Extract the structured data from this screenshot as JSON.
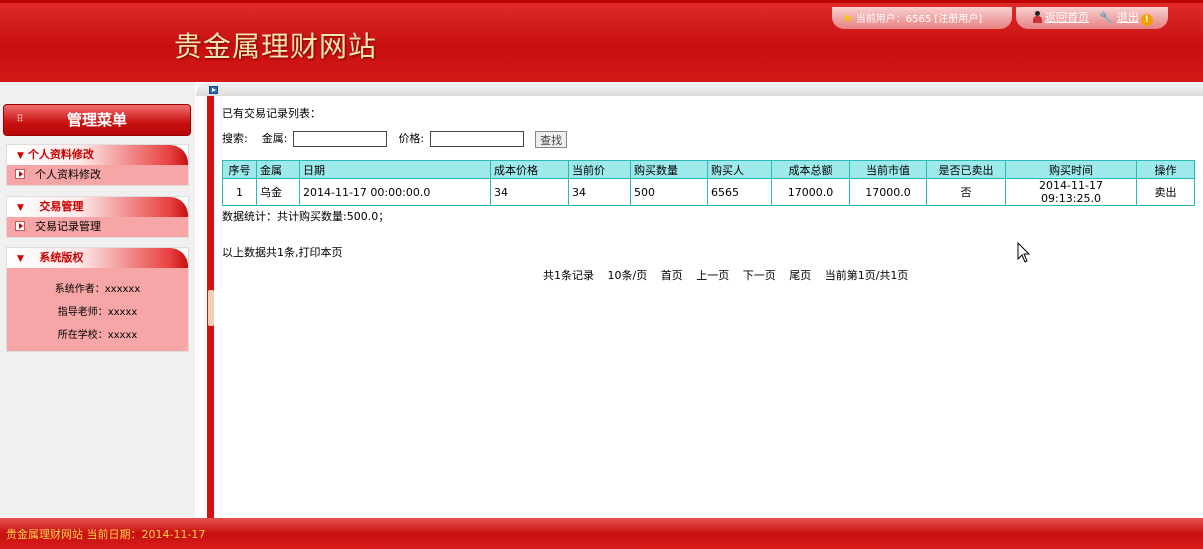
{
  "header": {
    "site_title": "贵金属理财网站",
    "current_user": "当前用户：6565 [注册用户]",
    "home_link": "返回首页",
    "logout_link": "退出"
  },
  "sidebar": {
    "menu_title": "管理菜单",
    "sections": [
      {
        "head": "个人资料修改",
        "items": [
          "个人资料修改"
        ]
      },
      {
        "head": "交易管理",
        "items": [
          "交易记录管理"
        ]
      },
      {
        "head": "系统版权",
        "lines": [
          "系统作者：xxxxxx",
          "指导老师：xxxxx",
          "所在学校：xxxxx"
        ]
      }
    ]
  },
  "content": {
    "list_caption": "已有交易记录列表：",
    "search": {
      "label": "搜索:",
      "metal_label": "金属:",
      "metal_value": "",
      "price_label": "价格:",
      "price_value": "",
      "button": "查找"
    },
    "table": {
      "columns": [
        "序号",
        "金属",
        "日期",
        "成本价格",
        "当前价",
        "购买数量",
        "购买人",
        "成本总额",
        "当前市值",
        "是否已卖出",
        "购买时间",
        "操作"
      ],
      "rows": [
        [
          "1",
          "乌金",
          "2014-11-17 00:00:00.0",
          "34",
          "34",
          "500",
          "6565",
          "17000.0",
          "17000.0",
          "否",
          "2014-11-17 09:13:25.0",
          "卖出"
        ]
      ]
    },
    "stats": "数据统计：共计购买数量:500.0；",
    "total_line": "以上数据共1条,打印本页",
    "pager": [
      "共1条记录",
      "10条/页",
      "首页",
      "上一页",
      "下一页",
      "尾页",
      "当前第1页/共1页"
    ]
  },
  "footer": {
    "text": "贵金属理财网站 当前日期：2014-11-17"
  }
}
